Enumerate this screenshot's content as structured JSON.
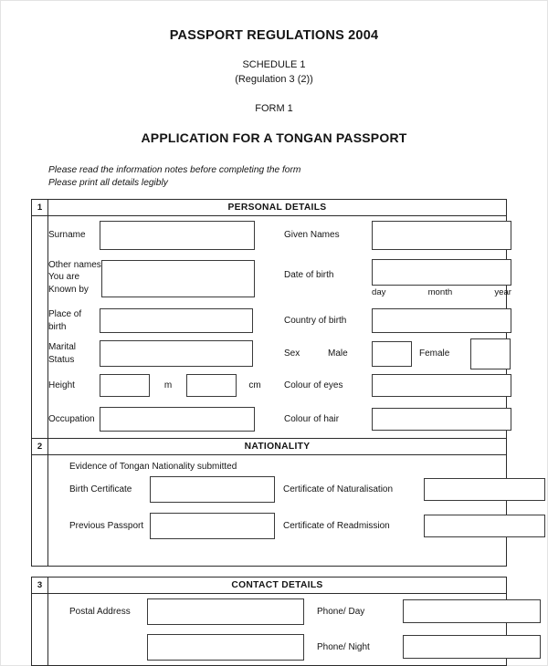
{
  "document": {
    "title_main": "PASSPORT REGULATIONS 2004",
    "schedule": "SCHEDULE 1",
    "regulation": "(Regulation 3 (2))",
    "form_number": "FORM 1",
    "title_sub": "APPLICATION FOR A TONGAN PASSPORT",
    "instruction_line_1": "Please read the information notes before completing the form",
    "instruction_line_2": "Please print all details legibly"
  },
  "sections": {
    "personal": {
      "number": "1",
      "title": "PERSONAL DETAILS",
      "fields": {
        "surname": {
          "label": "Surname",
          "value": ""
        },
        "given_names": {
          "label": "Given Names",
          "value": ""
        },
        "other_names_line1": "Other names",
        "other_names_line2": "You are",
        "other_names_line3": "Known by",
        "other_names_value": "",
        "date_of_birth": {
          "label": "Date of birth",
          "value": "",
          "day": "day",
          "month": "month",
          "year": "year"
        },
        "place_of_birth_line1": "Place of",
        "place_of_birth_line2": "birth",
        "place_of_birth_value": "",
        "country_of_birth": {
          "label": "Country of birth",
          "value": ""
        },
        "marital_status_line1": "Marital",
        "marital_status_line2": "Status",
        "marital_status_value": "",
        "sex": {
          "label": "Sex",
          "male_label": "Male",
          "male_value": "",
          "female_label": "Female",
          "female_value": ""
        },
        "height": {
          "label": "Height",
          "metres_value": "",
          "metres_unit": "m",
          "cm_value": "",
          "cm_unit": "cm"
        },
        "colour_of_eyes": {
          "label": "Colour of eyes",
          "value": ""
        },
        "occupation": {
          "label": "Occupation",
          "value": ""
        },
        "colour_of_hair": {
          "label": "Colour of hair",
          "value": ""
        }
      }
    },
    "nationality": {
      "number": "2",
      "title": "NATIONALITY",
      "note": "Evidence of Tongan Nationality submitted",
      "fields": {
        "birth_certificate": {
          "label": "Birth Certificate",
          "value": ""
        },
        "certificate_of_naturalisation": {
          "label": "Certificate of Naturalisation",
          "value": ""
        },
        "previous_passport": {
          "label": "Previous Passport",
          "value": ""
        },
        "certificate_of_readmission": {
          "label": "Certificate of Readmission",
          "value": ""
        }
      }
    },
    "contact": {
      "number": "3",
      "title": "CONTACT DETAILS",
      "fields": {
        "postal_address": {
          "label": "Postal Address",
          "line1_value": "",
          "line2_value": ""
        },
        "phone_day": {
          "label": "Phone/ Day",
          "value": ""
        },
        "phone_night": {
          "label": "Phone/ Night",
          "value": ""
        }
      }
    }
  }
}
